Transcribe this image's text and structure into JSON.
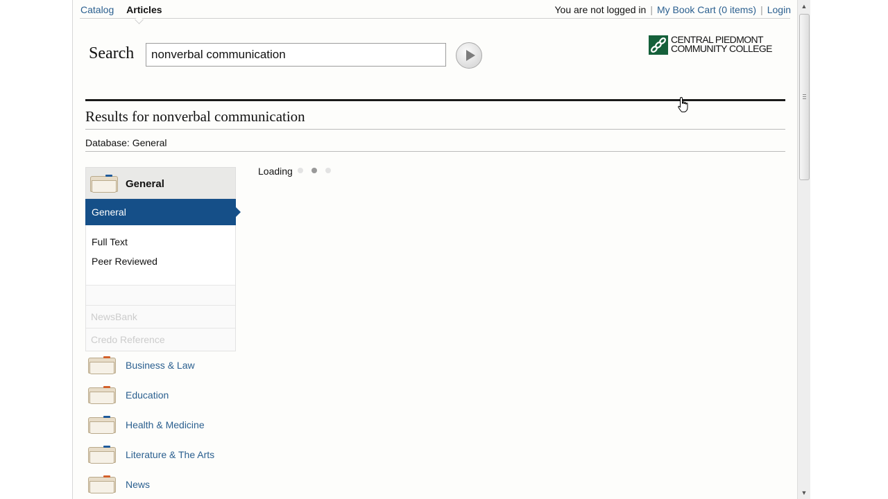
{
  "nav": {
    "catalog": "Catalog",
    "articles": "Articles"
  },
  "userbar": {
    "status": "You are not logged in",
    "sep": "|",
    "cart": "My Book Cart (0 items)",
    "login": "Login"
  },
  "search": {
    "label": "Search",
    "value": "nonverbal communication"
  },
  "logo": {
    "line1": "Central Piedmont",
    "line2": "Community College"
  },
  "results": {
    "title": "Results for nonverbal communication",
    "database_label": "Database: General"
  },
  "sidebar": {
    "active_category": "General",
    "active_subitem": "General",
    "filters": [
      "Full Text",
      "Peer Reviewed"
    ],
    "faded_items": [
      "NewsBank",
      "Credo Reference"
    ],
    "categories": [
      {
        "label": "Business & Law"
      },
      {
        "label": "Education"
      },
      {
        "label": "Health & Medicine"
      },
      {
        "label": "Literature & The Arts"
      },
      {
        "label": "News"
      }
    ]
  },
  "loading": {
    "text": "Loading"
  },
  "colors": {
    "link": "#2a5f8f",
    "active_bg": "#154f88",
    "folder_tab_blue": "#1e5a9a",
    "folder_tab_orange": "#d2602a",
    "logo_green": "#15603a"
  }
}
